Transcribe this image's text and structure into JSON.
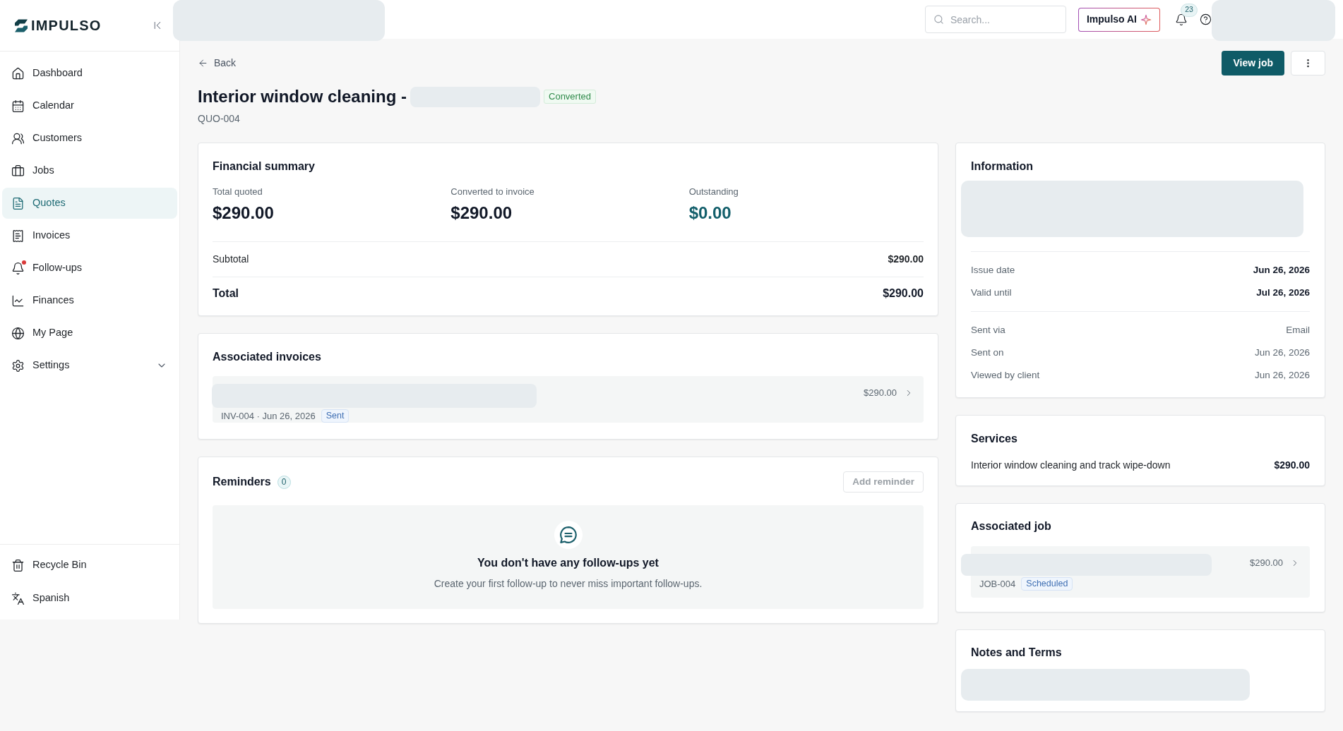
{
  "sidebar": {
    "logo": "IMPULSO",
    "nav_items": [
      {
        "label": "Dashboard",
        "kind": "link",
        "selected": false,
        "alert": false
      },
      {
        "label": "Calendar",
        "kind": "link",
        "selected": false,
        "alert": false
      },
      {
        "label": "Customers",
        "kind": "link",
        "selected": false,
        "alert": false
      },
      {
        "label": "Jobs",
        "kind": "link",
        "selected": false,
        "alert": false
      },
      {
        "label": "Quotes",
        "kind": "link",
        "selected": true,
        "alert": false
      },
      {
        "label": "Invoices",
        "kind": "link",
        "selected": false,
        "alert": false
      },
      {
        "label": "Follow-ups",
        "kind": "link",
        "selected": false,
        "alert": true
      },
      {
        "label": "Finances",
        "kind": "link",
        "selected": false,
        "alert": false
      },
      {
        "label": "My Page",
        "kind": "link",
        "selected": false,
        "alert": false
      },
      {
        "label": "Settings",
        "kind": "group",
        "selected": false,
        "alert": false,
        "expanded": false
      }
    ],
    "footer_items": [
      {
        "label": "Recycle Bin"
      },
      {
        "label": "Spanish"
      }
    ]
  },
  "top_bar": {
    "search": {
      "placeholder": "Search..."
    },
    "ai_button": "Impulso AI",
    "notification_count": "23"
  },
  "page_header": {
    "back_link": "Back",
    "title": "Interior window cleaning -",
    "status": "Converted",
    "quote_number": "QUO-004",
    "primary_button": "View job"
  },
  "financial_summary": {
    "title": "Financial summary",
    "metrics": [
      {
        "label": "Total quoted",
        "value": "$290.00",
        "kind": "plain"
      },
      {
        "label": "Converted to invoice",
        "value": "$290.00",
        "kind": "plain"
      },
      {
        "label": "Outstanding",
        "value": "$0.00",
        "kind": "accent"
      }
    ],
    "rows": [
      {
        "label": "Subtotal",
        "value": "$290.00",
        "kind": "subtotal"
      },
      {
        "label": "Total",
        "value": "$290.00",
        "kind": "total"
      }
    ]
  },
  "associated_invoices": {
    "title": "Associated invoices",
    "items": [
      {
        "reference": "INV-004 · Jun 26, 2026",
        "status": "Sent",
        "amount": "$290.00"
      }
    ]
  },
  "reminders": {
    "title": "Reminders",
    "count": "0",
    "add_button": {
      "label": "Add reminder",
      "disabled": true
    },
    "empty_state": {
      "title": "You don't have any follow-ups yet",
      "text": "Create your first follow-up to never miss important follow-ups."
    }
  },
  "information": {
    "title": "Information",
    "groups": [
      {
        "kind": "primary",
        "rows": [
          {
            "label": "Issue date",
            "value": "Jun 26, 2026"
          },
          {
            "label": "Valid until",
            "value": "Jul 26, 2026"
          }
        ]
      },
      {
        "kind": "secondary",
        "rows": [
          {
            "label": "Sent via",
            "value": "Email"
          },
          {
            "label": "Sent on",
            "value": "Jun 26, 2026"
          },
          {
            "label": "Viewed by client",
            "value": "Jun 26, 2026"
          }
        ]
      }
    ]
  },
  "services": {
    "title": "Services",
    "items": [
      {
        "name": "Interior window cleaning and track wipe-down",
        "price": "$290.00"
      }
    ]
  },
  "associated_job": {
    "title": "Associated job",
    "items": [
      {
        "reference": "JOB-004",
        "status": "Scheduled",
        "amount": "$290.00"
      }
    ]
  },
  "notes_and_terms": {
    "title": "Notes and Terms"
  }
}
